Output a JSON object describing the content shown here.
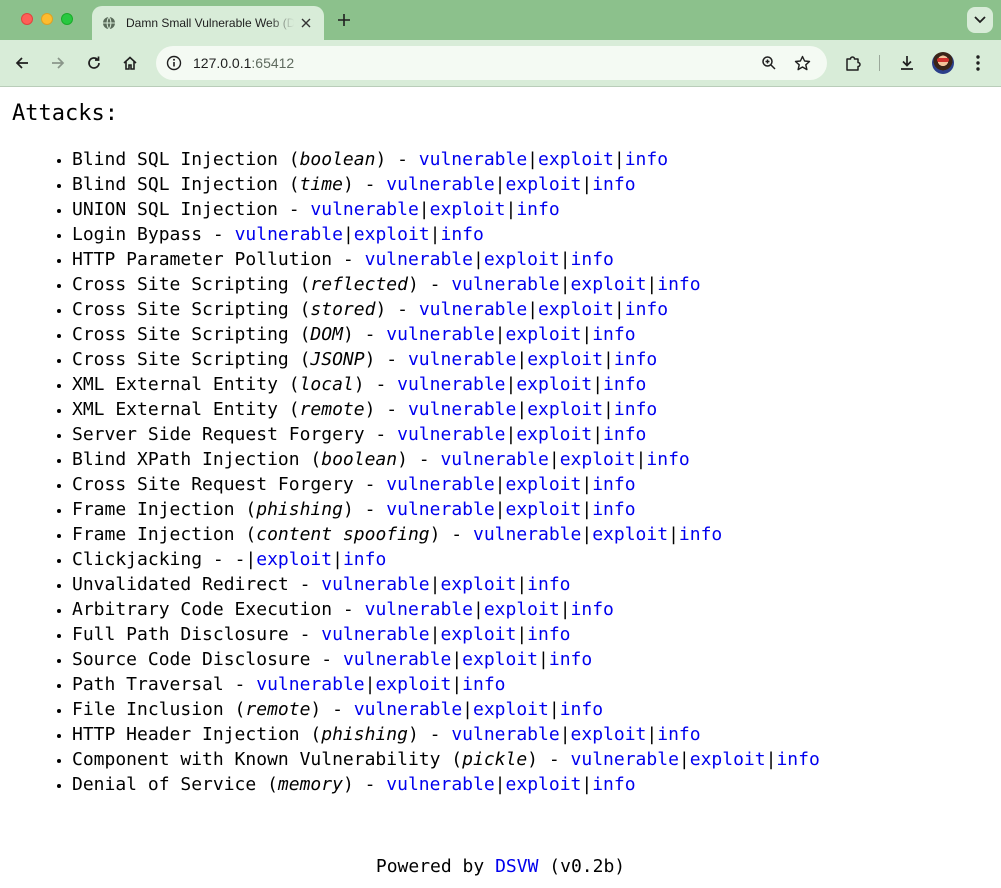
{
  "browser": {
    "tab_title": "Damn Small Vulnerable Web (DSVW)",
    "url_host": "127.0.0.1",
    "url_port": ":65412",
    "accent_color": "#8cc18c",
    "toolbar_color": "#d8ecd8"
  },
  "page": {
    "title": "Attacks:",
    "link_color": "#0000ee",
    "attacks": [
      {
        "name": "Blind SQL Injection (",
        "qualifier": "boolean",
        "suffix": ") - ",
        "vulnerable": "vulnerable",
        "exploit": "exploit",
        "info": "info"
      },
      {
        "name": "Blind SQL Injection (",
        "qualifier": "time",
        "suffix": ") - ",
        "vulnerable": "vulnerable",
        "exploit": "exploit",
        "info": "info"
      },
      {
        "name": "UNION SQL Injection - ",
        "qualifier": "",
        "suffix": "",
        "vulnerable": "vulnerable",
        "exploit": "exploit",
        "info": "info"
      },
      {
        "name": "Login Bypass - ",
        "qualifier": "",
        "suffix": "",
        "vulnerable": "vulnerable",
        "exploit": "exploit",
        "info": "info"
      },
      {
        "name": "HTTP Parameter Pollution - ",
        "qualifier": "",
        "suffix": "",
        "vulnerable": "vulnerable",
        "exploit": "exploit",
        "info": "info"
      },
      {
        "name": "Cross Site Scripting (",
        "qualifier": "reflected",
        "suffix": ") - ",
        "vulnerable": "vulnerable",
        "exploit": "exploit",
        "info": "info"
      },
      {
        "name": "Cross Site Scripting (",
        "qualifier": "stored",
        "suffix": ") - ",
        "vulnerable": "vulnerable",
        "exploit": "exploit",
        "info": "info"
      },
      {
        "name": "Cross Site Scripting (",
        "qualifier": "DOM",
        "suffix": ") - ",
        "vulnerable": "vulnerable",
        "exploit": "exploit",
        "info": "info"
      },
      {
        "name": "Cross Site Scripting (",
        "qualifier": "JSONP",
        "suffix": ") - ",
        "vulnerable": "vulnerable",
        "exploit": "exploit",
        "info": "info"
      },
      {
        "name": "XML External Entity (",
        "qualifier": "local",
        "suffix": ") - ",
        "vulnerable": "vulnerable",
        "exploit": "exploit",
        "info": "info"
      },
      {
        "name": "XML External Entity (",
        "qualifier": "remote",
        "suffix": ") - ",
        "vulnerable": "vulnerable",
        "exploit": "exploit",
        "info": "info"
      },
      {
        "name": "Server Side Request Forgery - ",
        "qualifier": "",
        "suffix": "",
        "vulnerable": "vulnerable",
        "exploit": "exploit",
        "info": "info"
      },
      {
        "name": "Blind XPath Injection (",
        "qualifier": "boolean",
        "suffix": ") - ",
        "vulnerable": "vulnerable",
        "exploit": "exploit",
        "info": "info"
      },
      {
        "name": "Cross Site Request Forgery - ",
        "qualifier": "",
        "suffix": "",
        "vulnerable": "vulnerable",
        "exploit": "exploit",
        "info": "info"
      },
      {
        "name": "Frame Injection (",
        "qualifier": "phishing",
        "suffix": ") - ",
        "vulnerable": "vulnerable",
        "exploit": "exploit",
        "info": "info"
      },
      {
        "name": "Frame Injection (",
        "qualifier": "content spoofing",
        "suffix": ") - ",
        "vulnerable": "vulnerable",
        "exploit": "exploit",
        "info": "info"
      },
      {
        "name": "Clickjacking - ",
        "qualifier": "",
        "suffix": "",
        "vulnerable": "-",
        "vulnerable_is_link": false,
        "exploit": "exploit",
        "info": "info"
      },
      {
        "name": "Unvalidated Redirect - ",
        "qualifier": "",
        "suffix": "",
        "vulnerable": "vulnerable",
        "exploit": "exploit",
        "info": "info"
      },
      {
        "name": "Arbitrary Code Execution - ",
        "qualifier": "",
        "suffix": "",
        "vulnerable": "vulnerable",
        "exploit": "exploit",
        "info": "info"
      },
      {
        "name": "Full Path Disclosure - ",
        "qualifier": "",
        "suffix": "",
        "vulnerable": "vulnerable",
        "exploit": "exploit",
        "info": "info"
      },
      {
        "name": "Source Code Disclosure - ",
        "qualifier": "",
        "suffix": "",
        "vulnerable": "vulnerable",
        "exploit": "exploit",
        "info": "info"
      },
      {
        "name": "Path Traversal - ",
        "qualifier": "",
        "suffix": "",
        "vulnerable": "vulnerable",
        "exploit": "exploit",
        "info": "info"
      },
      {
        "name": "File Inclusion (",
        "qualifier": "remote",
        "suffix": ") - ",
        "vulnerable": "vulnerable",
        "exploit": "exploit",
        "info": "info"
      },
      {
        "name": "HTTP Header Injection (",
        "qualifier": "phishing",
        "suffix": ") - ",
        "vulnerable": "vulnerable",
        "exploit": "exploit",
        "info": "info"
      },
      {
        "name": "Component with Known Vulnerability (",
        "qualifier": "pickle",
        "suffix": ") - ",
        "vulnerable": "vulnerable",
        "exploit": "exploit",
        "info": "info"
      },
      {
        "name": "Denial of Service (",
        "qualifier": "memory",
        "suffix": ") - ",
        "vulnerable": "vulnerable",
        "exploit": "exploit",
        "info": "info"
      }
    ],
    "separator": "|",
    "footer": {
      "prefix": "Powered by ",
      "link": "DSVW",
      "suffix": " (v0.2b)"
    }
  }
}
